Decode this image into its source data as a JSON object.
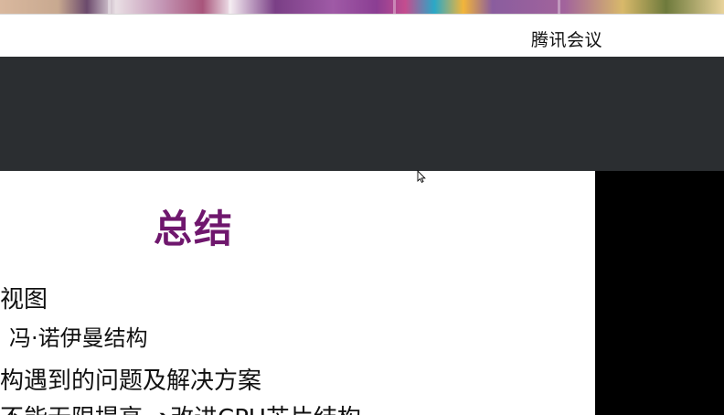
{
  "titlebar": {
    "app_name": "腾讯会议"
  },
  "slide": {
    "title": "总结",
    "lines": [
      "架视图",
      "冯·诺伊曼结构",
      "结构遇到的问题及解决方案",
      "率不能无限提高 ➔改进CPU芯片结构"
    ]
  },
  "colors": {
    "slide_title": "#6f176d",
    "toolbar_bg": "#2b2e31",
    "side_panel": "#000000"
  },
  "icons": {
    "cursor": "mouse-pointer-icon"
  }
}
